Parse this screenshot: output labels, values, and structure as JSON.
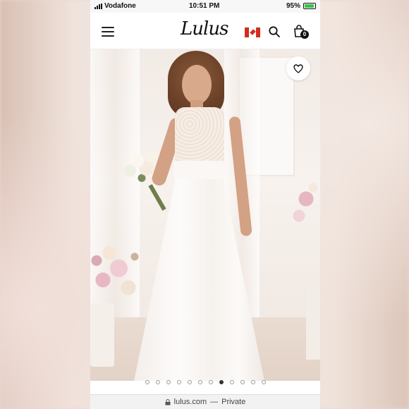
{
  "status_bar": {
    "carrier": "Vodafone",
    "time": "10:51 PM",
    "battery": "95%",
    "battery_level": 0.95
  },
  "header": {
    "logo_text": "Lulus",
    "cart_count": "0"
  },
  "product": {
    "gallery_total": 12,
    "gallery_active_index": 7
  },
  "browser": {
    "url": "lulus.com",
    "separator": "—",
    "mode": "Private"
  },
  "icons": {
    "menu": "hamburger-menu-icon",
    "region": "canada-flag-icon",
    "search": "search-icon",
    "cart": "shopping-bag-icon",
    "favorite": "heart-icon",
    "secure": "lock-icon"
  }
}
